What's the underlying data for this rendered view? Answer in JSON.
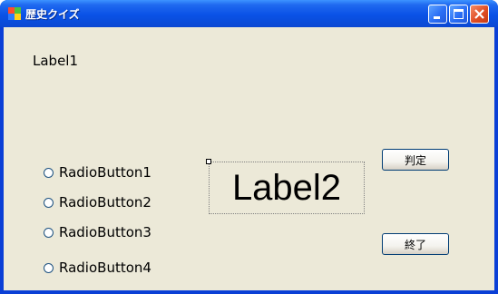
{
  "window": {
    "title": "歴史クイズ"
  },
  "icons": {
    "app": "app-icon",
    "minimize": "minimize-icon",
    "maximize": "maximize-icon",
    "close": "close-icon"
  },
  "colors": {
    "titlebar": "#0a52e6",
    "client_background": "#ece9d8",
    "close_button": "#e04d25",
    "radio_border": "#1c5180"
  },
  "form": {
    "label1": "Label1",
    "label2": "Label2",
    "radio_buttons": [
      {
        "label": "RadioButton1"
      },
      {
        "label": "RadioButton2"
      },
      {
        "label": "RadioButton3"
      },
      {
        "label": "RadioButton4"
      }
    ],
    "judge_button": "判定",
    "exit_button": "終了"
  }
}
